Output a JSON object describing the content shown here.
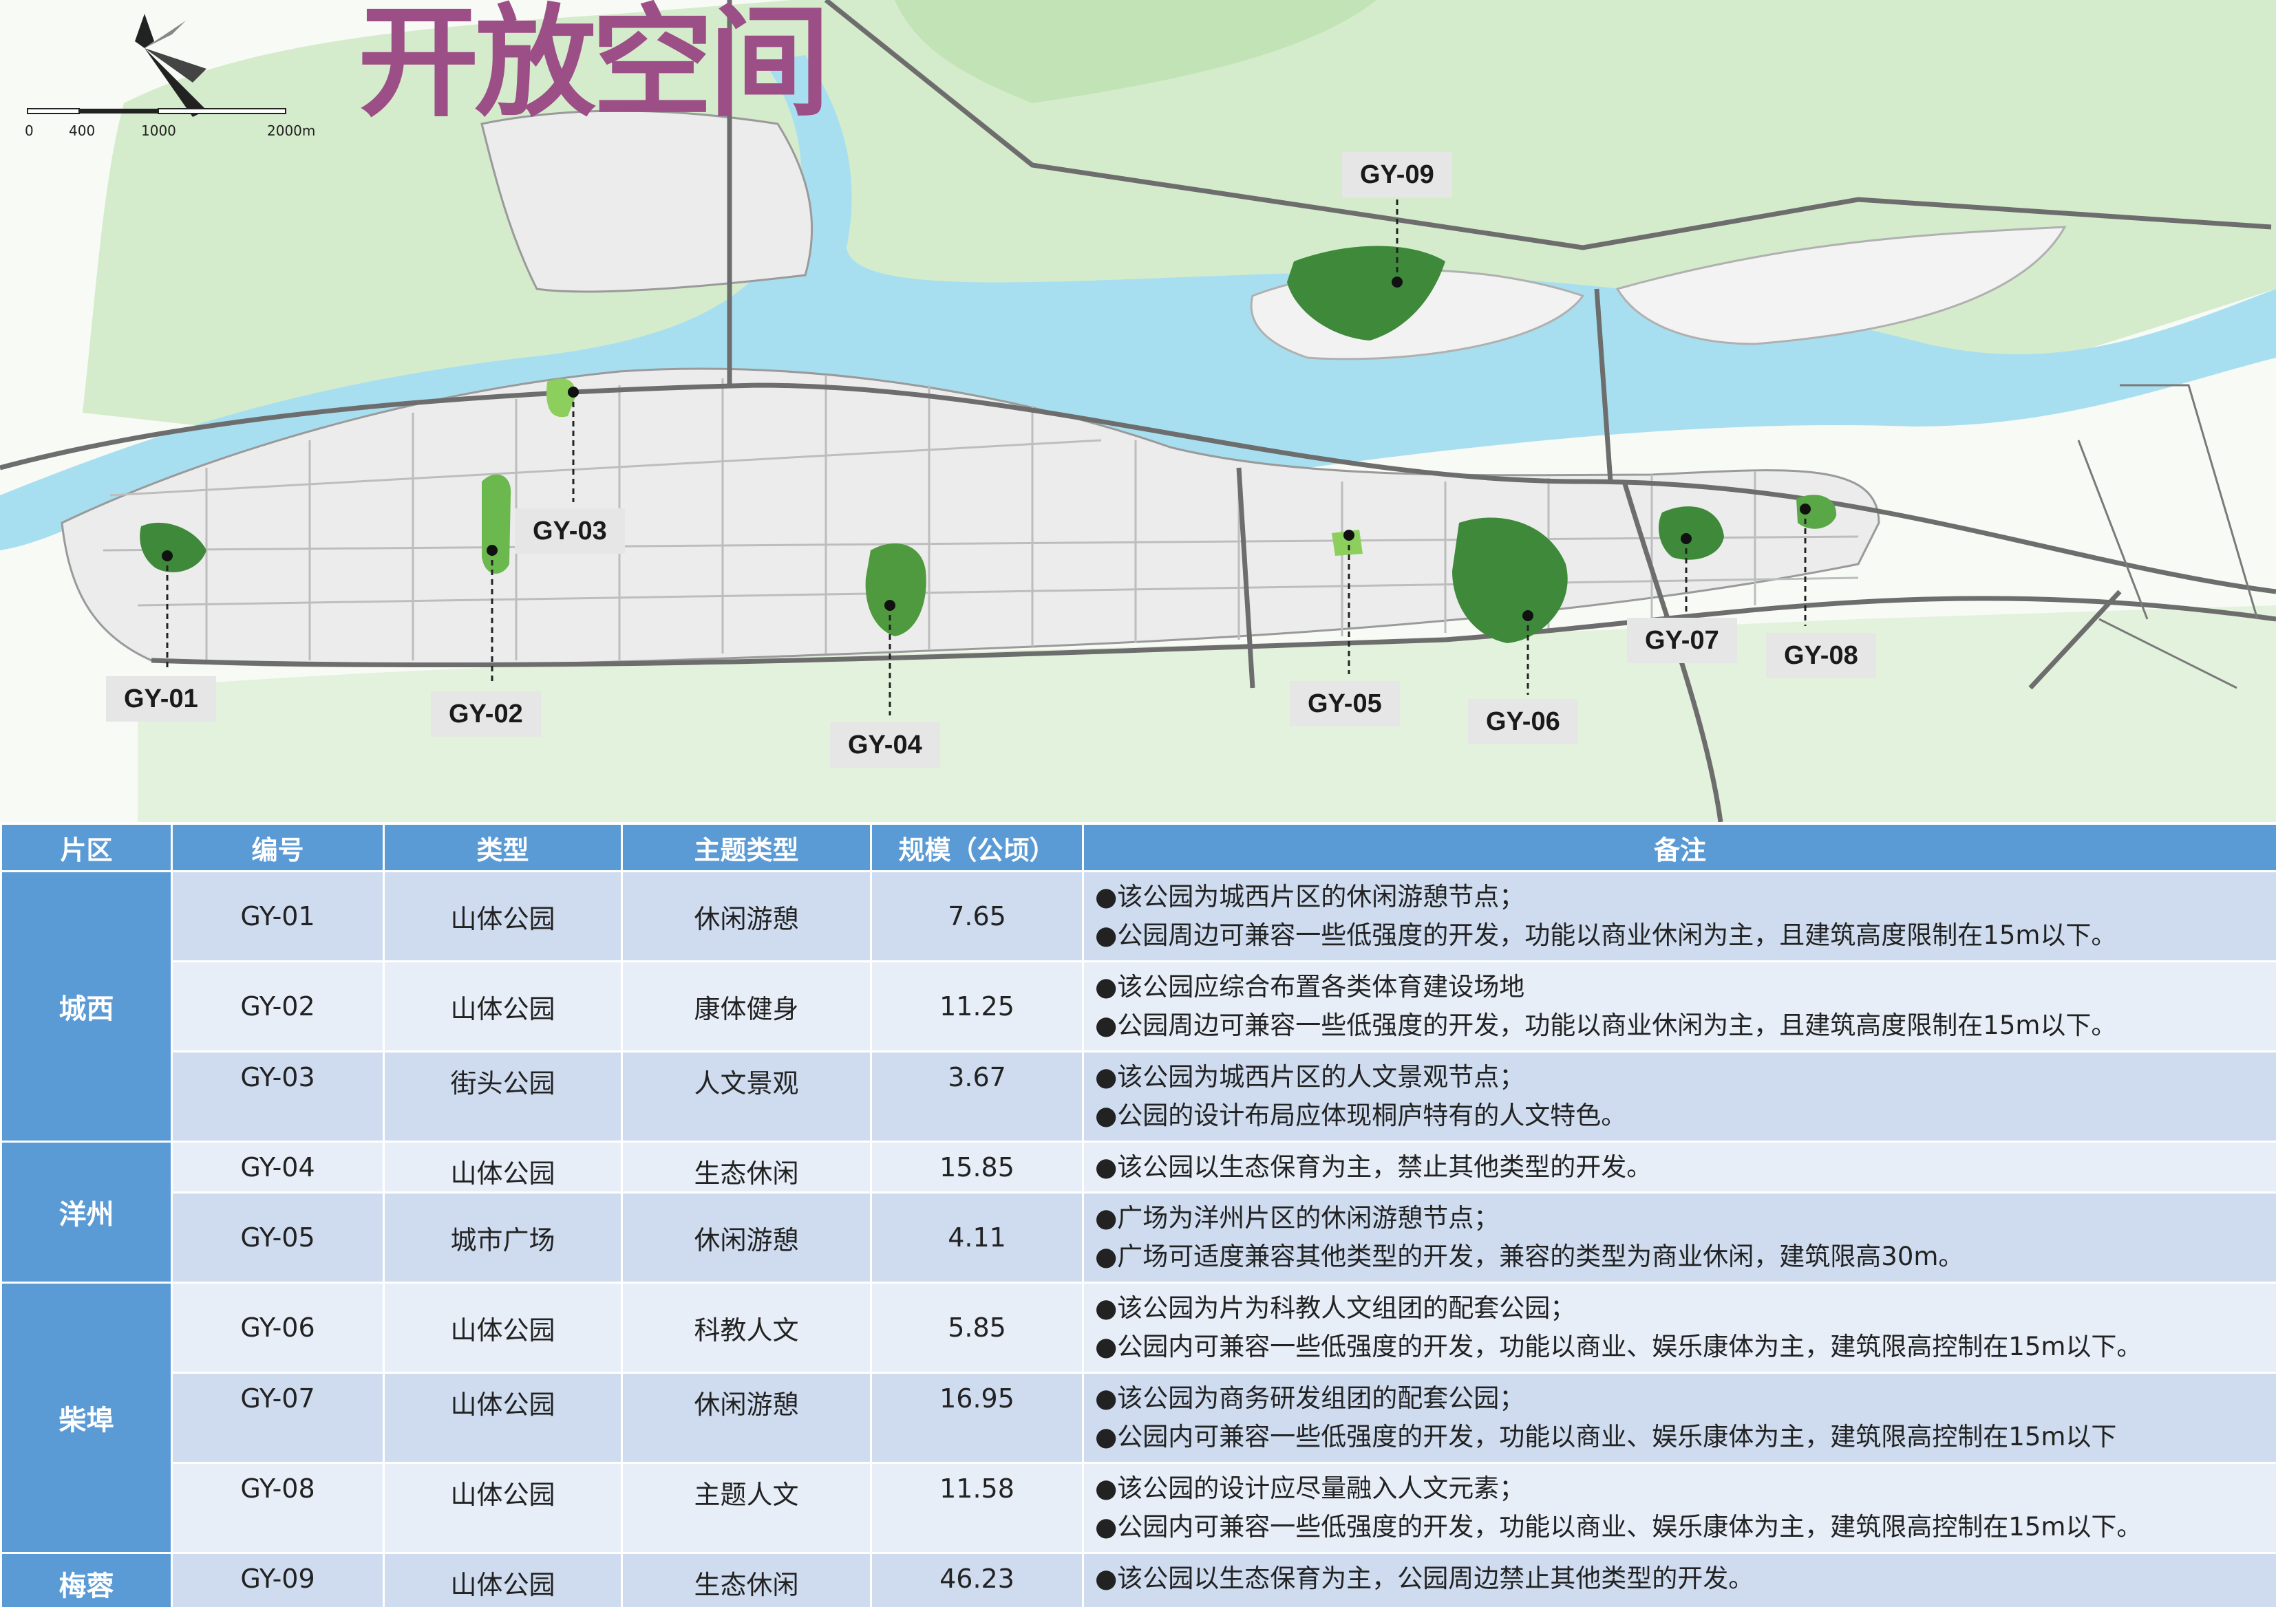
{
  "title": "开放空间",
  "scale_bar": {
    "labels": [
      "0",
      "400",
      "1000",
      "2000m"
    ]
  },
  "map_labels": [
    {
      "id": "GY-01",
      "text": "GY-01"
    },
    {
      "id": "GY-02",
      "text": "GY-02"
    },
    {
      "id": "GY-03",
      "text": "GY-03"
    },
    {
      "id": "GY-04",
      "text": "GY-04"
    },
    {
      "id": "GY-05",
      "text": "GY-05"
    },
    {
      "id": "GY-06",
      "text": "GY-06"
    },
    {
      "id": "GY-07",
      "text": "GY-07"
    },
    {
      "id": "GY-08",
      "text": "GY-08"
    },
    {
      "id": "GY-09",
      "text": "GY-09"
    }
  ],
  "colors": {
    "river": "#a8dff0",
    "hills": "#cfe8c4",
    "park_dark": "#3e8a3a",
    "park_light": "#7cc456",
    "table_header": "#5b9bd5",
    "title": "#9c4f86"
  },
  "table": {
    "headers": [
      "片区",
      "编号",
      "类型",
      "主题类型",
      "规模（公顷）",
      "备注"
    ],
    "districts": [
      "城西",
      "洋州",
      "柴埠",
      "梅蓉"
    ],
    "rows": [
      {
        "code": "GY-01",
        "type": "山体公园",
        "theme": "休闲游憩",
        "area": "7.65",
        "remarks": [
          "●该公园为城西片区的休闲游憩节点；",
          "●公园周边可兼容一些低强度的开发，功能以商业休闲为主，且建筑高度限制在15m以下。"
        ]
      },
      {
        "code": "GY-02",
        "type": "山体公园",
        "theme": "康体健身",
        "area": "11.25",
        "remarks": [
          "●该公园应综合布置各类体育建设场地",
          "●公园周边可兼容一些低强度的开发，功能以商业休闲为主，且建筑高度限制在15m以下。"
        ]
      },
      {
        "code": "GY-03",
        "type": "街头公园",
        "theme": "人文景观",
        "area": "3.67",
        "remarks": [
          "●该公园为城西片区的人文景观节点；",
          "●公园的设计布局应体现桐庐特有的人文特色。"
        ]
      },
      {
        "code": "GY-04",
        "type": "山体公园",
        "theme": "生态休闲",
        "area": "15.85",
        "remarks": [
          "●该公园以生态保育为主，禁止其他类型的开发。"
        ]
      },
      {
        "code": "GY-05",
        "type": "城市广场",
        "theme": "休闲游憩",
        "area": "4.11",
        "remarks": [
          "●广场为洋州片区的休闲游憩节点；",
          "●广场可适度兼容其他类型的开发，兼容的类型为商业休闲，建筑限高30m。"
        ]
      },
      {
        "code": "GY-06",
        "type": "山体公园",
        "theme": "科教人文",
        "area": "5.85",
        "remarks": [
          "●该公园为片为科教人文组团的配套公园；",
          "●公园内可兼容一些低强度的开发，功能以商业、娱乐康体为主，建筑限高控制在15m以下。"
        ]
      },
      {
        "code": "GY-07",
        "type": "山体公园",
        "theme": "休闲游憩",
        "area": "16.95",
        "remarks": [
          "●该公园为商务研发组团的配套公园；",
          "●公园内可兼容一些低强度的开发，功能以商业、娱乐康体为主，建筑限高控制在15m以下"
        ]
      },
      {
        "code": "GY-08",
        "type": "山体公园",
        "theme": "主题人文",
        "area": "11.58",
        "remarks": [
          "●该公园的设计应尽量融入人文元素；",
          "●公园内可兼容一些低强度的开发，功能以商业、娱乐康体为主，建筑限高控制在15m以下。"
        ]
      },
      {
        "code": "GY-09",
        "type": "山体公园",
        "theme": "生态休闲",
        "area": "46.23",
        "remarks": [
          "●该公园以生态保育为主，公园周边禁止其他类型的开发。"
        ]
      }
    ]
  }
}
